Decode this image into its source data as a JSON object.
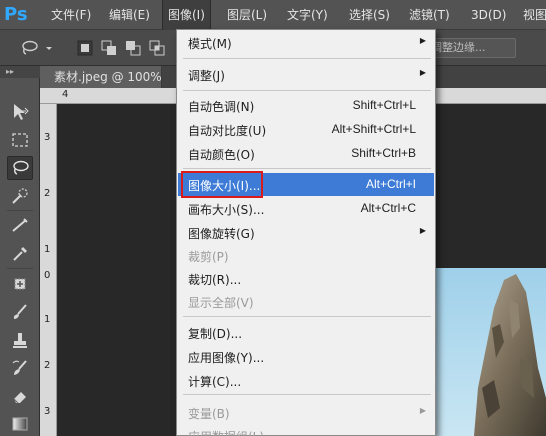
{
  "app": {
    "logo": "Ps"
  },
  "menubar": {
    "items": [
      "文件(F)",
      "编辑(E)",
      "图像(I)",
      "图层(L)",
      "文字(Y)",
      "选择(S)",
      "滤镜(T)",
      "3D(D)",
      "视图"
    ],
    "active_index": 2
  },
  "options_bar": {
    "refine_edge": "调整边缘..."
  },
  "document": {
    "tab_title": "素材.jpeg @ 100%"
  },
  "rulers": {
    "horizontal": [
      "4"
    ],
    "vertical": [
      "3",
      "2",
      "1",
      "0",
      "1",
      "2",
      "3"
    ]
  },
  "image_menu": {
    "items": [
      {
        "label": "模式(M)",
        "shortcut": "",
        "submenu": true,
        "disabled": false,
        "highlighted": false
      },
      {
        "label": "调整(J)",
        "shortcut": "",
        "submenu": true,
        "disabled": false,
        "highlighted": false
      },
      {
        "label": "自动色调(N)",
        "shortcut": "Shift+Ctrl+L",
        "submenu": false,
        "disabled": false,
        "highlighted": false
      },
      {
        "label": "自动对比度(U)",
        "shortcut": "Alt+Shift+Ctrl+L",
        "submenu": false,
        "disabled": false,
        "highlighted": false
      },
      {
        "label": "自动颜色(O)",
        "shortcut": "Shift+Ctrl+B",
        "submenu": false,
        "disabled": false,
        "highlighted": false
      },
      {
        "label": "图像大小(I)...",
        "shortcut": "Alt+Ctrl+I",
        "submenu": false,
        "disabled": false,
        "highlighted": true
      },
      {
        "label": "画布大小(S)...",
        "shortcut": "Alt+Ctrl+C",
        "submenu": false,
        "disabled": false,
        "highlighted": false
      },
      {
        "label": "图像旋转(G)",
        "shortcut": "",
        "submenu": true,
        "disabled": false,
        "highlighted": false
      },
      {
        "label": "裁剪(P)",
        "shortcut": "",
        "submenu": false,
        "disabled": true,
        "highlighted": false
      },
      {
        "label": "裁切(R)...",
        "shortcut": "",
        "submenu": false,
        "disabled": false,
        "highlighted": false
      },
      {
        "label": "显示全部(V)",
        "shortcut": "",
        "submenu": false,
        "disabled": true,
        "highlighted": false
      },
      {
        "label": "复制(D)...",
        "shortcut": "",
        "submenu": false,
        "disabled": false,
        "highlighted": false
      },
      {
        "label": "应用图像(Y)...",
        "shortcut": "",
        "submenu": false,
        "disabled": false,
        "highlighted": false
      },
      {
        "label": "计算(C)...",
        "shortcut": "",
        "submenu": false,
        "disabled": false,
        "highlighted": false
      },
      {
        "label": "变量(B)",
        "shortcut": "",
        "submenu": true,
        "disabled": true,
        "highlighted": false
      },
      {
        "label": "应用数据组(L)...",
        "shortcut": "",
        "submenu": false,
        "disabled": true,
        "highlighted": false
      }
    ]
  },
  "colors": {
    "highlight": "#3d7bd6",
    "annotation_box": "#d91b1b",
    "logo": "#31a8ff"
  },
  "tools": [
    "move-tool-icon",
    "marquee-tool-icon",
    "lasso-tool-icon",
    "quick-select-tool-icon",
    "crop-tool-icon",
    "eyedropper-tool-icon",
    "healing-brush-tool-icon",
    "brush-tool-icon",
    "clone-stamp-tool-icon",
    "history-brush-tool-icon",
    "eraser-tool-icon",
    "gradient-tool-icon"
  ]
}
